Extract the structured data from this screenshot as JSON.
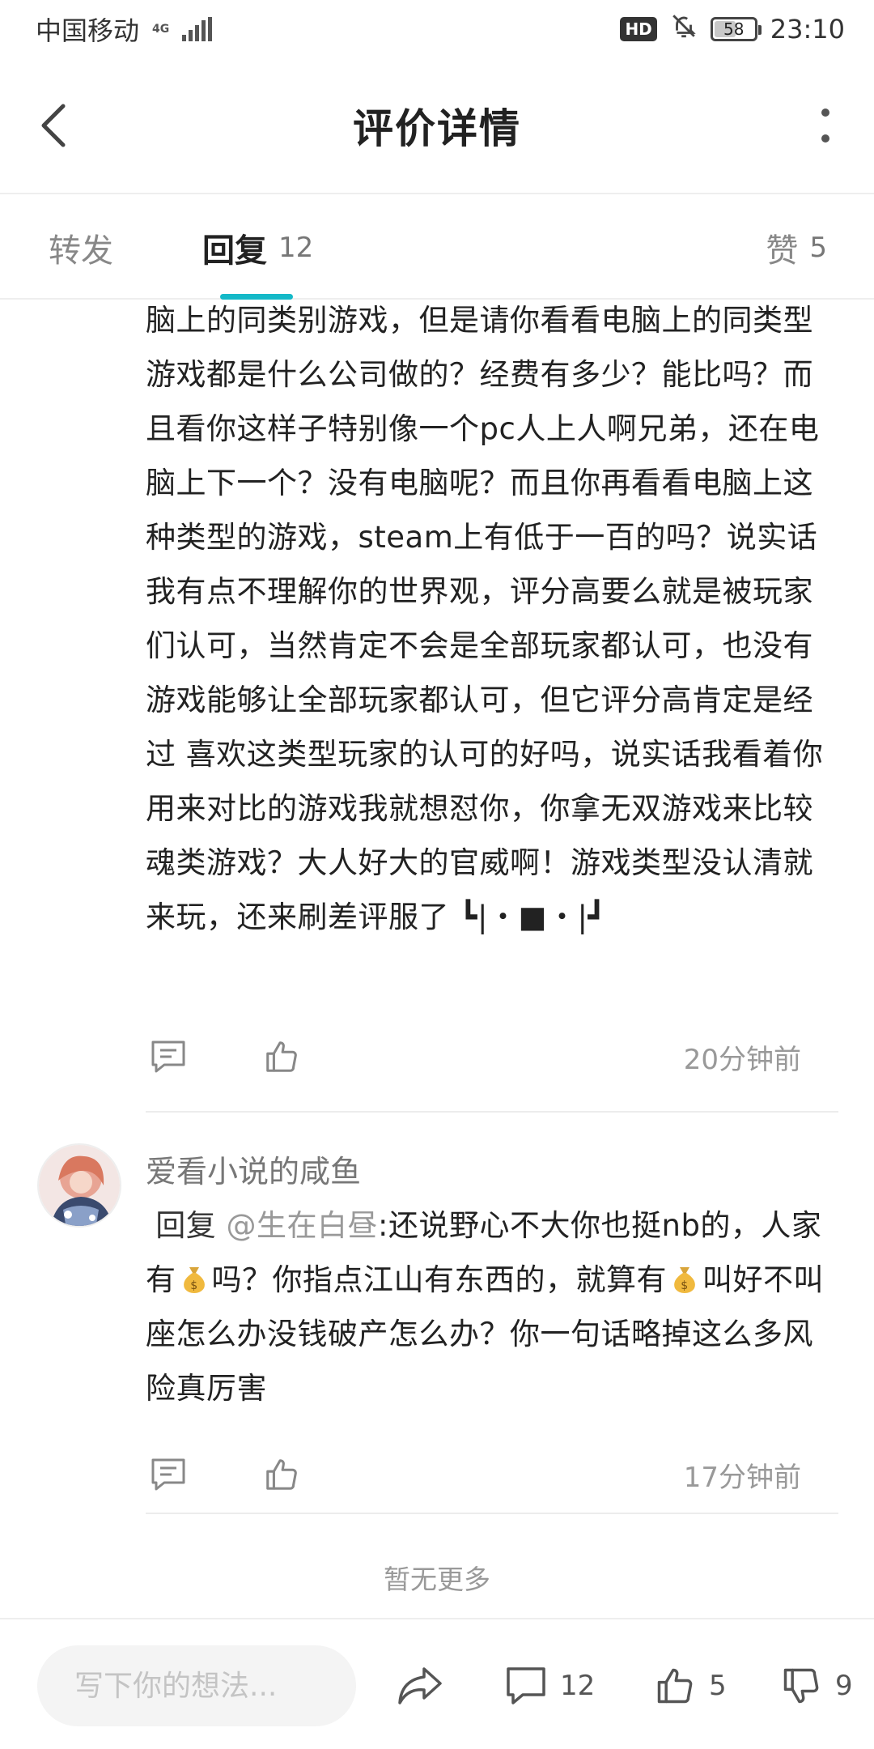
{
  "status_bar": {
    "carrier": "中国移动",
    "network": "4G",
    "hd_badge": "HD",
    "battery": "58",
    "battery_level": 0.58,
    "time": "23:10"
  },
  "header": {
    "title": "评价详情"
  },
  "tabs": [
    {
      "label": "转发",
      "count": ""
    },
    {
      "label": "回复",
      "count": "12"
    },
    {
      "label": "赞",
      "count": "5"
    }
  ],
  "comments": [
    {
      "text": "脑上的同类别游戏，但是请你看看电脑上的同类型游戏都是什么公司做的？经费有多少？能比吗？而且看你这样子特别像一个pc人上人啊兄弟，还在电脑上下一个？没有电脑呢？而且你再看看电脑上这种类型的游戏，steam上有低于一百的吗？说实话我有点不理解你的世界观，评分高要么就是被玩家们认可，当然肯定不会是全部玩家都认可，也没有游戏能够让全部玩家都认可，但它评分高肯定是经过 喜欢这类型玩家的认可的好吗，说实话我看着你用来对比的游戏我就想怼你，你拿无双游戏来比较魂类游戏？大人好大的官威啊！游戏类型没认清就来玩，还来刷差评服了 ┗|・■・|┛",
      "time": "20分钟前"
    },
    {
      "username": "爱看小说的咸鱼",
      "reply_prefix": "回复",
      "mention": "@生在白昼",
      "text_part1": ":还说野心不大你也挺nb的，人家有",
      "text_part2": "吗？你指点江山有东西的，就算有",
      "text_part3": "叫好不叫座怎么办没钱破产怎么办？你一句话略掉这么多风险真厉害",
      "time": "17分钟前"
    }
  ],
  "no_more": "暂无更多",
  "bottom_bar": {
    "input_placeholder": "写下你的想法...",
    "comment_count": "12",
    "like_count": "5",
    "dislike_count": "9"
  },
  "colors": {
    "accent": "#14b9c8",
    "text_primary": "#222222",
    "text_secondary": "#999999"
  }
}
